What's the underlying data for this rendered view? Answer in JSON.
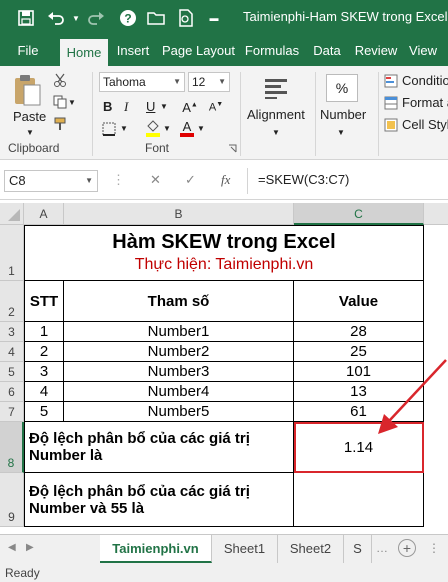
{
  "window": {
    "title": "Taimienphi-Ham SKEW trong Excel.xls"
  },
  "quick_access": [
    {
      "name": "save-icon",
      "glyph": "save"
    },
    {
      "name": "undo-icon",
      "glyph": "undo"
    },
    {
      "name": "redo-icon",
      "glyph": "redo"
    },
    {
      "name": "help-icon",
      "glyph": "?"
    }
  ],
  "ribbon_tabs": [
    {
      "label": "File"
    },
    {
      "label": "Home",
      "active": true
    },
    {
      "label": "Insert"
    },
    {
      "label": "Page Layout"
    },
    {
      "label": "Formulas"
    },
    {
      "label": "Data"
    },
    {
      "label": "Review"
    },
    {
      "label": "View"
    }
  ],
  "ribbon": {
    "clipboard": {
      "paste_label": "Paste",
      "group_label": "Clipboard"
    },
    "font": {
      "font_name": "Tahoma",
      "font_size": "12",
      "group_label": "Font",
      "bold": "B",
      "italic": "I",
      "underline": "U"
    },
    "alignment": {
      "label": "Alignment"
    },
    "number": {
      "label": "Number",
      "symbol": "%"
    },
    "styles": {
      "conditional": "Conditio",
      "format_as": "Format a",
      "cell_styles": "Cell Style"
    }
  },
  "formula_bar": {
    "name_box": "C8",
    "cancel": "✕",
    "enter": "✓",
    "fx": "fx",
    "formula": "=SKEW(C3:C7)"
  },
  "columns": [
    "A",
    "B",
    "C"
  ],
  "rows": [
    "1",
    "2",
    "3",
    "4",
    "5",
    "6",
    "7",
    "8",
    "9"
  ],
  "sheet": {
    "title": "Hàm SKEW trong Excel",
    "subtitle": "Thực hiện: Taimienphi.vn",
    "headers": {
      "stt": "STT",
      "param": "Tham số",
      "value": "Value"
    },
    "data_rows": [
      {
        "stt": "1",
        "param": "Number1",
        "value": "28"
      },
      {
        "stt": "2",
        "param": "Number2",
        "value": "25"
      },
      {
        "stt": "3",
        "param": "Number3",
        "value": "101"
      },
      {
        "stt": "4",
        "param": "Number4",
        "value": "13"
      },
      {
        "stt": "5",
        "param": "Number5",
        "value": "61"
      }
    ],
    "row8_label": "Độ lệch phân bổ của các giá trị Number là",
    "row8_value": "1.14",
    "row9_label": "Độ lệch phân bổ của các giá trị Number và 55 là",
    "row9_value": ""
  },
  "sheet_tabs": [
    {
      "label": "Taimienphi.vn",
      "active": true
    },
    {
      "label": "Sheet1"
    },
    {
      "label": "Sheet2"
    },
    {
      "label": "S"
    }
  ],
  "status": {
    "text": "Ready"
  },
  "colors": {
    "accent": "#217346",
    "highlight": "#d9262c",
    "title_red": "#c00000"
  }
}
